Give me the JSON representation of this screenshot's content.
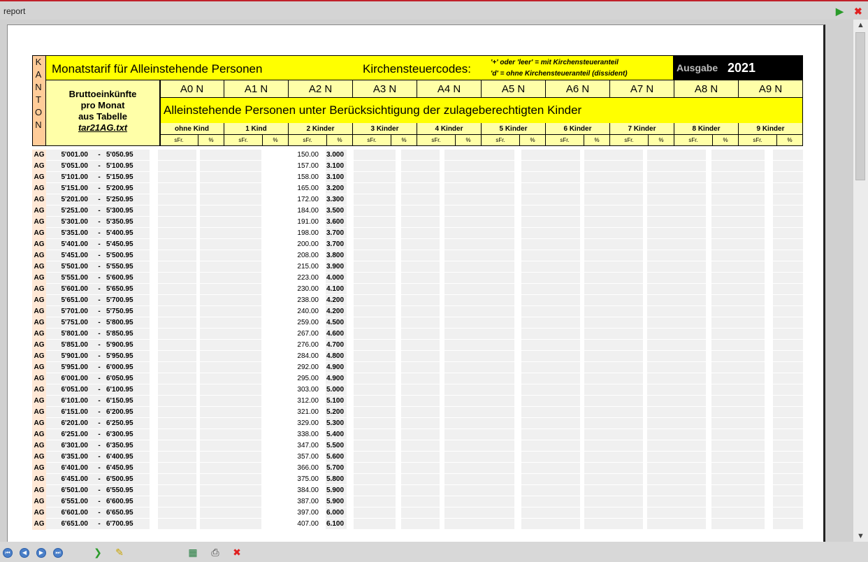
{
  "window": {
    "title": "report"
  },
  "report": {
    "kanton_letters": [
      "K",
      "A",
      "N",
      "T",
      "O",
      "N"
    ],
    "title": "Monatstarif für Alleinstehende Personen",
    "kirchensteuer_label": "Kirchensteuercodes:",
    "kirchensteuer_notes": [
      "'+' oder 'leer' = mit Kirchensteueranteil",
      "'d' = ohne Kirchensteueranteil (dissident)"
    ],
    "ausgabe_label": "Ausgabe",
    "ausgabe_year": "2021",
    "brutto_lines": [
      "Bruttoeinkünfte",
      "pro Monat",
      "aus Tabelle",
      "tar21AG.txt"
    ],
    "tarif_codes": [
      "A0 N",
      "A1 N",
      "A2 N",
      "A3 N",
      "A4 N",
      "A5 N",
      "A6 N",
      "A7 N",
      "A8 N",
      "A9 N"
    ],
    "subtitle": "Alleinstehende Personen unter Berücksichtigung der zulageberechtigten Kinder",
    "kinder_labels": [
      "ohne Kind",
      "1 Kind",
      "2 Kinder",
      "3 Kinder",
      "4 Kinder",
      "5 Kinder",
      "6 Kinder",
      "7 Kinder",
      "8 Kinder",
      "9 Kinder"
    ],
    "unit_sfr": "sFr.",
    "unit_pct": "%",
    "dash": "-",
    "rows": [
      {
        "kt": "AG",
        "from": "5'001.00",
        "to": "5'050.95",
        "sfr": "150.00",
        "pct": "3.000"
      },
      {
        "kt": "AG",
        "from": "5'051.00",
        "to": "5'100.95",
        "sfr": "157.00",
        "pct": "3.100"
      },
      {
        "kt": "AG",
        "from": "5'101.00",
        "to": "5'150.95",
        "sfr": "158.00",
        "pct": "3.100"
      },
      {
        "kt": "AG",
        "from": "5'151.00",
        "to": "5'200.95",
        "sfr": "165.00",
        "pct": "3.200"
      },
      {
        "kt": "AG",
        "from": "5'201.00",
        "to": "5'250.95",
        "sfr": "172.00",
        "pct": "3.300"
      },
      {
        "kt": "AG",
        "from": "5'251.00",
        "to": "5'300.95",
        "sfr": "184.00",
        "pct": "3.500"
      },
      {
        "kt": "AG",
        "from": "5'301.00",
        "to": "5'350.95",
        "sfr": "191.00",
        "pct": "3.600"
      },
      {
        "kt": "AG",
        "from": "5'351.00",
        "to": "5'400.95",
        "sfr": "198.00",
        "pct": "3.700"
      },
      {
        "kt": "AG",
        "from": "5'401.00",
        "to": "5'450.95",
        "sfr": "200.00",
        "pct": "3.700"
      },
      {
        "kt": "AG",
        "from": "5'451.00",
        "to": "5'500.95",
        "sfr": "208.00",
        "pct": "3.800"
      },
      {
        "kt": "AG",
        "from": "5'501.00",
        "to": "5'550.95",
        "sfr": "215.00",
        "pct": "3.900"
      },
      {
        "kt": "AG",
        "from": "5'551.00",
        "to": "5'600.95",
        "sfr": "223.00",
        "pct": "4.000"
      },
      {
        "kt": "AG",
        "from": "5'601.00",
        "to": "5'650.95",
        "sfr": "230.00",
        "pct": "4.100"
      },
      {
        "kt": "AG",
        "from": "5'651.00",
        "to": "5'700.95",
        "sfr": "238.00",
        "pct": "4.200"
      },
      {
        "kt": "AG",
        "from": "5'701.00",
        "to": "5'750.95",
        "sfr": "240.00",
        "pct": "4.200"
      },
      {
        "kt": "AG",
        "from": "5'751.00",
        "to": "5'800.95",
        "sfr": "259.00",
        "pct": "4.500"
      },
      {
        "kt": "AG",
        "from": "5'801.00",
        "to": "5'850.95",
        "sfr": "267.00",
        "pct": "4.600"
      },
      {
        "kt": "AG",
        "from": "5'851.00",
        "to": "5'900.95",
        "sfr": "276.00",
        "pct": "4.700"
      },
      {
        "kt": "AG",
        "from": "5'901.00",
        "to": "5'950.95",
        "sfr": "284.00",
        "pct": "4.800"
      },
      {
        "kt": "AG",
        "from": "5'951.00",
        "to": "6'000.95",
        "sfr": "292.00",
        "pct": "4.900"
      },
      {
        "kt": "AG",
        "from": "6'001.00",
        "to": "6'050.95",
        "sfr": "295.00",
        "pct": "4.900"
      },
      {
        "kt": "AG",
        "from": "6'051.00",
        "to": "6'100.95",
        "sfr": "303.00",
        "pct": "5.000"
      },
      {
        "kt": "AG",
        "from": "6'101.00",
        "to": "6'150.95",
        "sfr": "312.00",
        "pct": "5.100"
      },
      {
        "kt": "AG",
        "from": "6'151.00",
        "to": "6'200.95",
        "sfr": "321.00",
        "pct": "5.200"
      },
      {
        "kt": "AG",
        "from": "6'201.00",
        "to": "6'250.95",
        "sfr": "329.00",
        "pct": "5.300"
      },
      {
        "kt": "AG",
        "from": "6'251.00",
        "to": "6'300.95",
        "sfr": "338.00",
        "pct": "5.400"
      },
      {
        "kt": "AG",
        "from": "6'301.00",
        "to": "6'350.95",
        "sfr": "347.00",
        "pct": "5.500"
      },
      {
        "kt": "AG",
        "from": "6'351.00",
        "to": "6'400.95",
        "sfr": "357.00",
        "pct": "5.600"
      },
      {
        "kt": "AG",
        "from": "6'401.00",
        "to": "6'450.95",
        "sfr": "366.00",
        "pct": "5.700"
      },
      {
        "kt": "AG",
        "from": "6'451.00",
        "to": "6'500.95",
        "sfr": "375.00",
        "pct": "5.800"
      },
      {
        "kt": "AG",
        "from": "6'501.00",
        "to": "6'550.95",
        "sfr": "384.00",
        "pct": "5.900"
      },
      {
        "kt": "AG",
        "from": "6'551.00",
        "to": "6'600.95",
        "sfr": "387.00",
        "pct": "5.900"
      },
      {
        "kt": "AG",
        "from": "6'601.00",
        "to": "6'650.95",
        "sfr": "397.00",
        "pct": "6.000"
      },
      {
        "kt": "AG",
        "from": "6'651.00",
        "to": "6'700.95",
        "sfr": "407.00",
        "pct": "6.100"
      }
    ]
  },
  "icons": {
    "titlebar": [
      "go-arrow-icon",
      "close-icon"
    ],
    "navigation": [
      "first-page-icon",
      "previous-page-icon",
      "next-page-icon",
      "last-page-icon"
    ],
    "toolbar": [
      "run-arrow-icon",
      "edit-pencil-icon",
      "export-excel-icon",
      "print-icon",
      "delete-icon"
    ]
  },
  "colors": {
    "yellow": "#ffff00",
    "pale_yellow": "#ffffa8",
    "kanton_orange": "#ffcc99",
    "close_red": "#e02020",
    "go_green": "#2a9b2a"
  }
}
